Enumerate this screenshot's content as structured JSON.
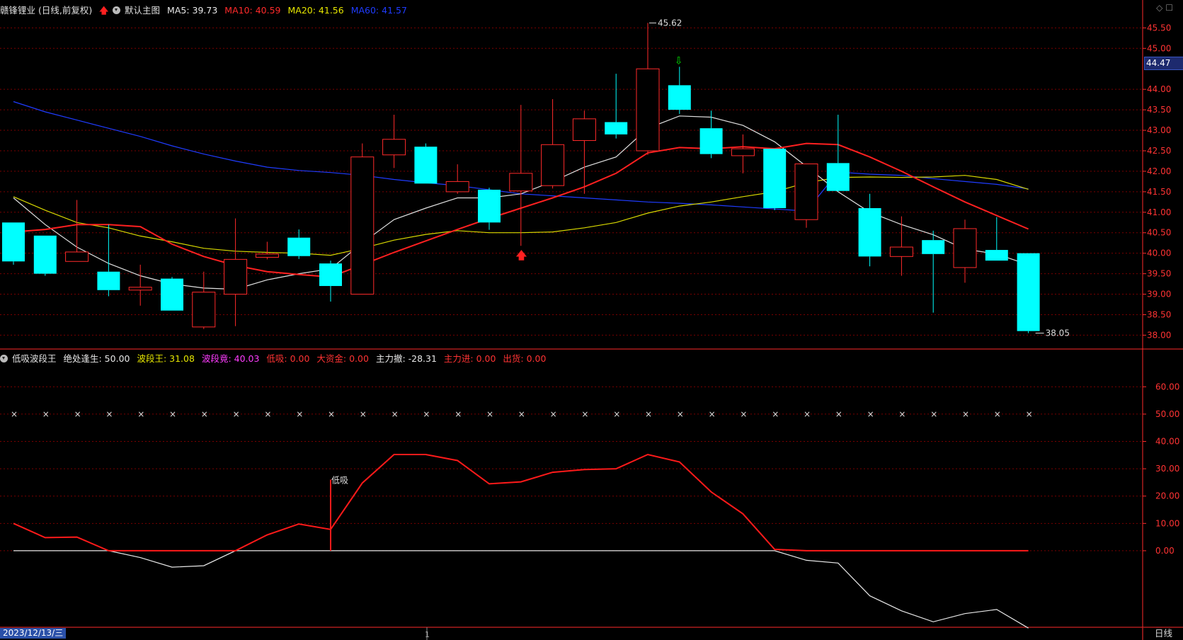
{
  "header": {
    "title": "赣锋锂业 (日线,前复权)",
    "main_chart_label": "默认主图",
    "ma": [
      {
        "label": "MA5: 39.73",
        "color": "#e8e8e8"
      },
      {
        "label": "MA10: 40.59",
        "color": "#ff2a2a"
      },
      {
        "label": "MA20: 41.56",
        "color": "#e6e600"
      },
      {
        "label": "MA60: 41.57",
        "color": "#1f3cff"
      }
    ]
  },
  "indicator_header": {
    "name": "低吸波段王",
    "items": [
      {
        "label": "绝处逢生: 50.00",
        "color": "#e8e8e8"
      },
      {
        "label": "波段王: 31.08",
        "color": "#e6e600"
      },
      {
        "label": "波段竟: 40.03",
        "color": "#ff3cff"
      },
      {
        "label": "低吸: 0.00",
        "color": "#ff3333"
      },
      {
        "label": "大资金: 0.00",
        "color": "#ff3333"
      },
      {
        "label": "主力撤: -28.31",
        "color": "#e8e8e8"
      },
      {
        "label": "主力进: 0.00",
        "color": "#ff3333"
      },
      {
        "label": "出货: 0.00",
        "color": "#ff3333"
      }
    ]
  },
  "price_tag": "44.47",
  "high_label": "45.62",
  "low_label": "38.05",
  "buy_signal_label": "低吸",
  "footer": {
    "date": "2023/12/13/三",
    "period": "日线",
    "axis_marker": "1"
  },
  "colors": {
    "up": "#ff2a2a",
    "down": "#00ffff",
    "grid": "#7a0000",
    "axis": "#ff2a2a"
  },
  "chart_data": {
    "type": "candlestick",
    "price_axis": {
      "ylim": [
        37.8,
        45.8
      ],
      "ticks": [
        38.0,
        38.5,
        39.0,
        39.5,
        40.0,
        40.5,
        41.0,
        41.5,
        42.0,
        42.5,
        43.0,
        43.5,
        44.0,
        45.0,
        45.5
      ]
    },
    "candles": [
      {
        "o": 40.75,
        "c": 39.8,
        "h": 40.75,
        "l": 39.72
      },
      {
        "o": 40.43,
        "c": 39.5,
        "h": 40.43,
        "l": 39.45
      },
      {
        "o": 39.8,
        "c": 40.03,
        "h": 41.3,
        "l": 39.8
      },
      {
        "o": 39.55,
        "c": 39.1,
        "h": 40.7,
        "l": 38.95
      },
      {
        "o": 39.1,
        "c": 39.17,
        "h": 39.72,
        "l": 38.72
      },
      {
        "o": 39.38,
        "c": 38.6,
        "h": 39.42,
        "l": 38.6
      },
      {
        "o": 38.2,
        "c": 39.05,
        "h": 39.55,
        "l": 38.15
      },
      {
        "o": 39.0,
        "c": 39.85,
        "h": 40.85,
        "l": 38.22
      },
      {
        "o": 39.9,
        "c": 39.98,
        "h": 40.28,
        "l": 39.85
      },
      {
        "o": 40.38,
        "c": 39.93,
        "h": 40.58,
        "l": 39.86
      },
      {
        "o": 39.75,
        "c": 39.2,
        "h": 39.82,
        "l": 38.82
      },
      {
        "o": 39.0,
        "c": 42.35,
        "h": 42.68,
        "l": 39.0
      },
      {
        "o": 42.4,
        "c": 42.78,
        "h": 43.38,
        "l": 42.08
      },
      {
        "o": 42.6,
        "c": 41.7,
        "h": 42.68,
        "l": 41.7
      },
      {
        "o": 41.5,
        "c": 41.75,
        "h": 42.17,
        "l": 41.45
      },
      {
        "o": 41.55,
        "c": 40.75,
        "h": 41.6,
        "l": 40.57
      },
      {
        "o": 41.52,
        "c": 41.95,
        "h": 43.62,
        "l": 40.18
      },
      {
        "o": 41.65,
        "c": 42.65,
        "h": 43.76,
        "l": 41.58
      },
      {
        "o": 42.75,
        "c": 43.28,
        "h": 43.48,
        "l": 41.45
      },
      {
        "o": 43.2,
        "c": 42.9,
        "h": 44.38,
        "l": 42.8
      },
      {
        "o": 42.5,
        "c": 44.5,
        "h": 45.62,
        "l": 42.4
      },
      {
        "o": 44.1,
        "c": 43.5,
        "h": 44.55,
        "l": 43.4
      },
      {
        "o": 43.05,
        "c": 42.42,
        "h": 43.48,
        "l": 42.32
      },
      {
        "o": 42.38,
        "c": 42.55,
        "h": 42.9,
        "l": 41.95
      },
      {
        "o": 42.55,
        "c": 41.1,
        "h": 42.55,
        "l": 41.05
      },
      {
        "o": 40.82,
        "c": 42.18,
        "h": 42.18,
        "l": 40.62
      },
      {
        "o": 42.2,
        "c": 41.52,
        "h": 43.38,
        "l": 41.5
      },
      {
        "o": 41.1,
        "c": 39.92,
        "h": 41.45,
        "l": 39.68
      },
      {
        "o": 39.92,
        "c": 40.15,
        "h": 40.9,
        "l": 39.45
      },
      {
        "o": 40.32,
        "c": 39.98,
        "h": 40.55,
        "l": 38.55
      },
      {
        "o": 39.65,
        "c": 40.6,
        "h": 40.82,
        "l": 39.28
      },
      {
        "o": 40.08,
        "c": 39.82,
        "h": 40.88,
        "l": 39.82
      },
      {
        "o": 40.0,
        "c": 38.1,
        "h": 40.0,
        "l": 38.05
      }
    ],
    "ma5": [
      41.35,
      40.7,
      40.15,
      39.75,
      39.45,
      39.25,
      39.15,
      39.12,
      39.35,
      39.5,
      39.62,
      40.25,
      40.82,
      41.1,
      41.35,
      41.35,
      41.45,
      41.75,
      42.1,
      42.35,
      43.05,
      43.35,
      43.32,
      43.12,
      42.72,
      42.12,
      41.5,
      41.0,
      40.7,
      40.45,
      40.1,
      39.98,
      39.72
    ],
    "ma10": [
      40.52,
      40.58,
      40.7,
      40.7,
      40.65,
      40.22,
      39.92,
      39.7,
      39.55,
      39.48,
      39.42,
      39.72,
      40.02,
      40.3,
      40.58,
      40.85,
      41.1,
      41.35,
      41.62,
      41.95,
      42.45,
      42.58,
      42.55,
      42.6,
      42.55,
      42.68,
      42.65,
      42.35,
      42.0,
      41.62,
      41.25,
      40.92,
      40.59
    ],
    "ma20": [
      41.38,
      41.05,
      40.75,
      40.62,
      40.42,
      40.28,
      40.12,
      40.05,
      40.02,
      40.0,
      39.95,
      40.12,
      40.32,
      40.46,
      40.55,
      40.5,
      40.5,
      40.52,
      40.62,
      40.75,
      40.98,
      41.15,
      41.25,
      41.38,
      41.5,
      41.72,
      41.85,
      41.86,
      41.85,
      41.86,
      41.9,
      41.8,
      41.56
    ],
    "ma60": [
      43.7,
      43.45,
      43.25,
      43.05,
      42.85,
      42.62,
      42.42,
      42.25,
      42.1,
      42.02,
      41.97,
      41.9,
      41.8,
      41.72,
      41.65,
      41.55,
      41.45,
      41.4,
      41.35,
      41.3,
      41.25,
      41.22,
      41.18,
      41.13,
      41.08,
      41.03,
      41.98,
      41.93,
      41.9,
      41.82,
      41.75,
      41.68,
      41.57
    ],
    "indicator": {
      "ylim": [
        -28,
        72
      ],
      "ticks": [
        0,
        10,
        20,
        30,
        40,
        50,
        60
      ],
      "marker_level": 50,
      "red_line": [
        10.0,
        4.8,
        5.0,
        0.0,
        0.0,
        0.0,
        0.0,
        0.0,
        5.8,
        9.8,
        7.8,
        24.8,
        35.2,
        35.2,
        33.0,
        24.5,
        25.2,
        28.7,
        29.7,
        30.0,
        35.2,
        32.5,
        21.5,
        13.5,
        0.5,
        0.0,
        0.0,
        0.0,
        0.0,
        0.0,
        0.0,
        0.0,
        0.0
      ],
      "white_line": [
        0,
        0,
        0,
        0,
        -2.5,
        -6.0,
        -5.5,
        0,
        0,
        0,
        0,
        0,
        0,
        0,
        0,
        0,
        0,
        0,
        0,
        0,
        0,
        0,
        0,
        0,
        0,
        -3.5,
        -4.5,
        -16.5,
        -22.0,
        -26.0,
        -23.0,
        -21.5,
        -28.3
      ],
      "signal_index": 10
    }
  }
}
